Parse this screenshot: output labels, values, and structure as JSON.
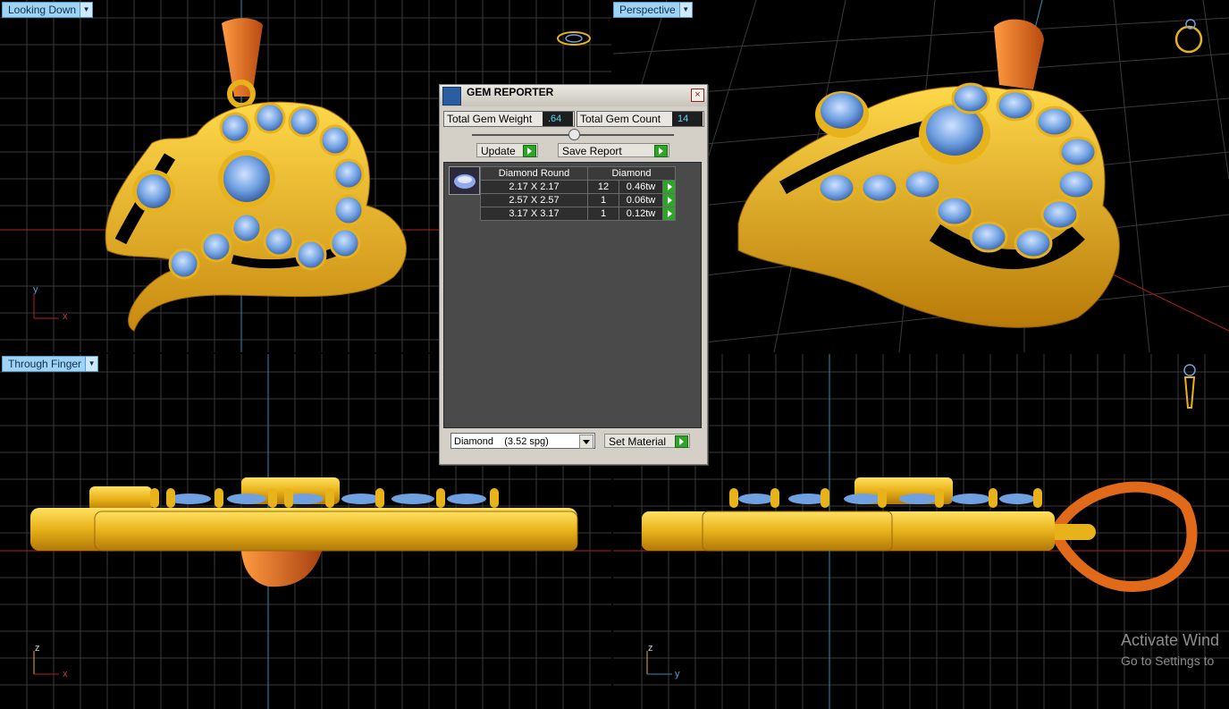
{
  "viewports": {
    "top_left": {
      "label": "Looking Down",
      "axis_1": "y",
      "axis_2": "x"
    },
    "top_right": {
      "label": "Perspective"
    },
    "bottom_left": {
      "label": "Through Finger",
      "axis_1": "z",
      "axis_2": "x"
    },
    "bottom_right": {
      "axis_1": "z",
      "axis_2": "y"
    }
  },
  "gem_reporter": {
    "title": "GEM REPORTER",
    "close": "×",
    "total_weight_label": "Total Gem Weight",
    "total_weight_value": ".64",
    "total_count_label": "Total Gem Count",
    "total_count_value": "14",
    "update_button": "Update",
    "save_report_button": "Save Report",
    "table": {
      "headers": [
        "Diamond Round",
        "Diamond"
      ],
      "rows": [
        {
          "size": "2.17 X 2.17",
          "count": "12",
          "weight": "0.46tw"
        },
        {
          "size": "2.57 X 2.57",
          "count": "1",
          "weight": "0.06tw"
        },
        {
          "size": "3.17 X 3.17",
          "count": "1",
          "weight": "0.12tw"
        }
      ]
    },
    "material_select": "Diamond    (3.52 spg)",
    "set_material_button": "Set Material"
  },
  "watermark": {
    "line1": "Activate Wind",
    "line2": "Go to Settings to"
  },
  "colors": {
    "label_bg": "#9fd3f5",
    "gold": "#e8b21a",
    "gem": "#6fa0e0",
    "bail": "#e0691a",
    "accent_value": "#5ad3ff",
    "go_green": "#2fa32a"
  }
}
